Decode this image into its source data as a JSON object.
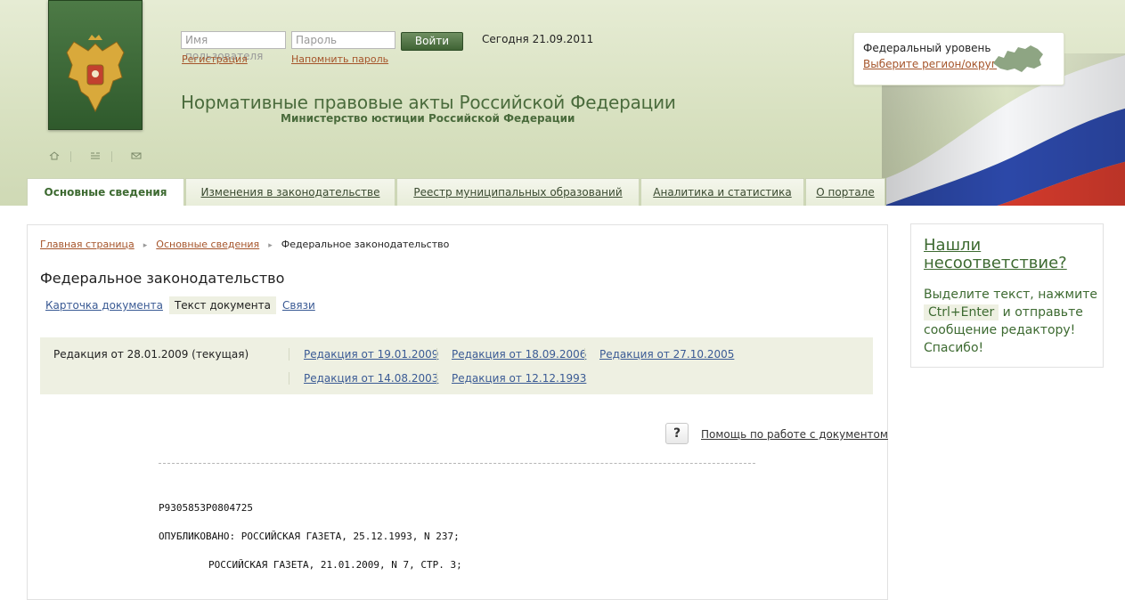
{
  "header": {
    "login": {
      "username_placeholder": "Имя пользователя",
      "password_placeholder": "Пароль",
      "submit_label": "Войти",
      "register_link": "Регистрация",
      "remind_password_link": "Напомнить пароль"
    },
    "today": "Сегодня 21.09.2011",
    "site_title": "Нормативные правовые акты Российской Федерации",
    "site_subtitle": "Министерство юстиции Российской Федерации",
    "region": {
      "label": "Федеральный уровень",
      "select_link": "Выберите регион/округ"
    }
  },
  "nav": {
    "tabs": [
      {
        "label": "Основные сведения",
        "active": true
      },
      {
        "label": "Изменения в законодательстве"
      },
      {
        "label": "Реестр муниципальных образований"
      },
      {
        "label": "Аналитика и статистика"
      },
      {
        "label": "О портале"
      }
    ]
  },
  "breadcrumb": {
    "items": [
      "Главная страница",
      "Основные сведения"
    ],
    "current": "Федеральное законодательство"
  },
  "page": {
    "title": "Федеральное законодательство",
    "subtabs": [
      {
        "label": "Карточка документа"
      },
      {
        "label": "Текст документа",
        "active": true
      },
      {
        "label": "Связи"
      }
    ]
  },
  "editions": {
    "current": "Редакция от 28.01.2009 (текущая)",
    "links": [
      "Редакция от 19.01.2009",
      "Редакция от 18.09.2006",
      "Редакция от 27.10.2005",
      "Редакция от 14.08.2003",
      "Редакция от 12.12.1993"
    ]
  },
  "help": {
    "icon_text": "?",
    "link": "Помощь по работе с документом"
  },
  "document": {
    "id": "P9305853P0804725",
    "published_line1": "ОПУБЛИКОВАНО: РОССИЙСКАЯ ГАЗЕТА, 25.12.1993, N 237;",
    "published_line2": "РОССИЙСКАЯ ГАЗЕТА, 21.01.2009, N 7, СТР. 3;"
  },
  "sidebar": {
    "title": "Нашли несоответствие?",
    "text_before": "Выделите текст, нажмите",
    "shortcut": "Ctrl+Enter",
    "text_after": "и отправьте сообщение редактору! Спасибо!"
  },
  "colors": {
    "header_bg": "#d7e0bf",
    "brand_green": "#3d6a31",
    "link_blue": "#3a5a94",
    "link_orange": "#a5542a",
    "panel_tint": "#eef0e2"
  }
}
